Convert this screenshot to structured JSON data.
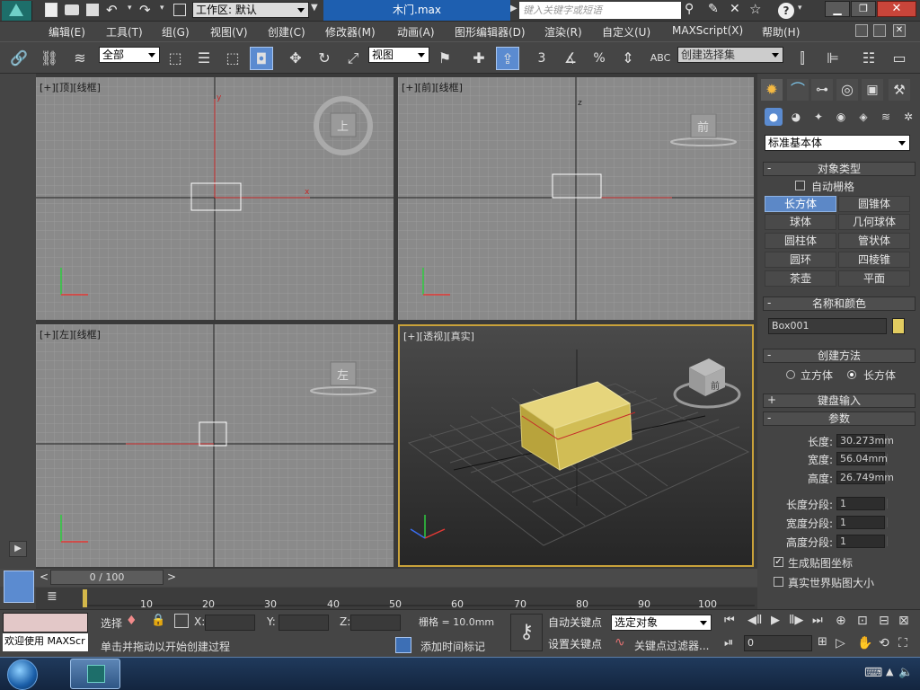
{
  "titlebar": {
    "workspace_label": "工作区: 默认",
    "filename": "木门.max",
    "search_placeholder": "键入关键字或短语"
  },
  "menu": [
    "编辑(E)",
    "工具(T)",
    "组(G)",
    "视图(V)",
    "创建(C)",
    "修改器(M)",
    "动画(A)",
    "图形编辑器(D)",
    "渲染(R)",
    "自定义(U)",
    "MAXScript(X)",
    "帮助(H)"
  ],
  "toolbar": {
    "selection_filter": "全部",
    "ref_coord": "视图",
    "named_selection": "创建选择集",
    "snap_3": "3",
    "snap_pct": "%"
  },
  "viewports": {
    "top": "[+][顶][线框]",
    "front": "[+][前][线框]",
    "left": "[+][左][线框]",
    "persp": "[+][透视][真实]"
  },
  "viewcube": {
    "top": "上",
    "front": "前",
    "left": "左",
    "persp": "前"
  },
  "axis": {
    "x": "x",
    "y": "y",
    "z": "z"
  },
  "cmdpanel": {
    "category": "标准基本体",
    "object_type_title": "对象类型",
    "autogrid": "自动栅格",
    "buttons": [
      "长方体",
      "圆锥体",
      "球体",
      "几何球体",
      "圆柱体",
      "管状体",
      "圆环",
      "四棱锥",
      "茶壶",
      "平面"
    ],
    "name_color_title": "名称和颜色",
    "object_name": "Box001",
    "object_color": "#e2cc60",
    "creation_method_title": "创建方法",
    "creation_cube": "立方体",
    "creation_box": "长方体",
    "keyboard_entry": "键盘输入",
    "params_title": "参数",
    "length_label": "长度:",
    "length": "30.273mm",
    "width_label": "宽度:",
    "width": "56.04mm",
    "height_label": "高度:",
    "height": "26.749mm",
    "lseg_label": "长度分段:",
    "lseg": "1",
    "wseg_label": "宽度分段:",
    "wseg": "1",
    "hseg_label": "高度分段:",
    "hseg": "1",
    "gen_map": "生成贴图坐标",
    "real_world": "真实世界贴图大小"
  },
  "timeline": {
    "frame": "0 / 100",
    "ticks": [
      "10",
      "20",
      "30",
      "40",
      "50",
      "60",
      "70",
      "80",
      "90",
      "100"
    ]
  },
  "status": {
    "welcome": "欢迎使用 MAXScr",
    "sel_label": "选择",
    "x_label": "X:",
    "y_label": "Y:",
    "z_label": "Z:",
    "grid": "栅格 = 10.0mm",
    "prompt": "单击并拖动以开始创建过程",
    "add_time_tag": "添加时间标记",
    "auto_key": "自动关键点",
    "set_key": "设置关键点",
    "selected_obj": "选定对象",
    "key_filter": "关键点过滤器...",
    "frame_value": "0"
  }
}
